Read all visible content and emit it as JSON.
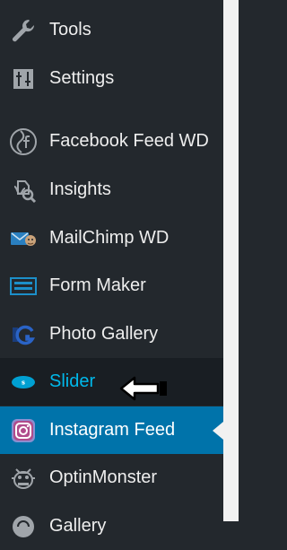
{
  "menu": {
    "items": [
      {
        "label": "Tools",
        "icon": "wrench-icon"
      },
      {
        "label": "Settings",
        "icon": "settings-sliders-icon"
      },
      {
        "label": "Facebook Feed WD",
        "icon": "facebook-feed-icon"
      },
      {
        "label": "Insights",
        "icon": "insights-icon"
      },
      {
        "label": "MailChimp WD",
        "icon": "mailchimp-icon"
      },
      {
        "label": "Form Maker",
        "icon": "form-maker-icon"
      },
      {
        "label": "Photo Gallery",
        "icon": "photo-gallery-icon"
      },
      {
        "label": "Slider",
        "icon": "slider-icon",
        "state": "hover"
      },
      {
        "label": "Instagram Feed",
        "icon": "instagram-icon",
        "state": "current"
      },
      {
        "label": "OptinMonster",
        "icon": "optinmonster-icon"
      },
      {
        "label": "Gallery",
        "icon": "gallery-icon"
      }
    ]
  },
  "colors": {
    "sidebar_bg": "#23282d",
    "hover_bg": "#191e23",
    "hover_text": "#00b9eb",
    "current_bg": "#0073aa",
    "text": "#eeeeee",
    "content_bg": "#f1f1f1"
  }
}
